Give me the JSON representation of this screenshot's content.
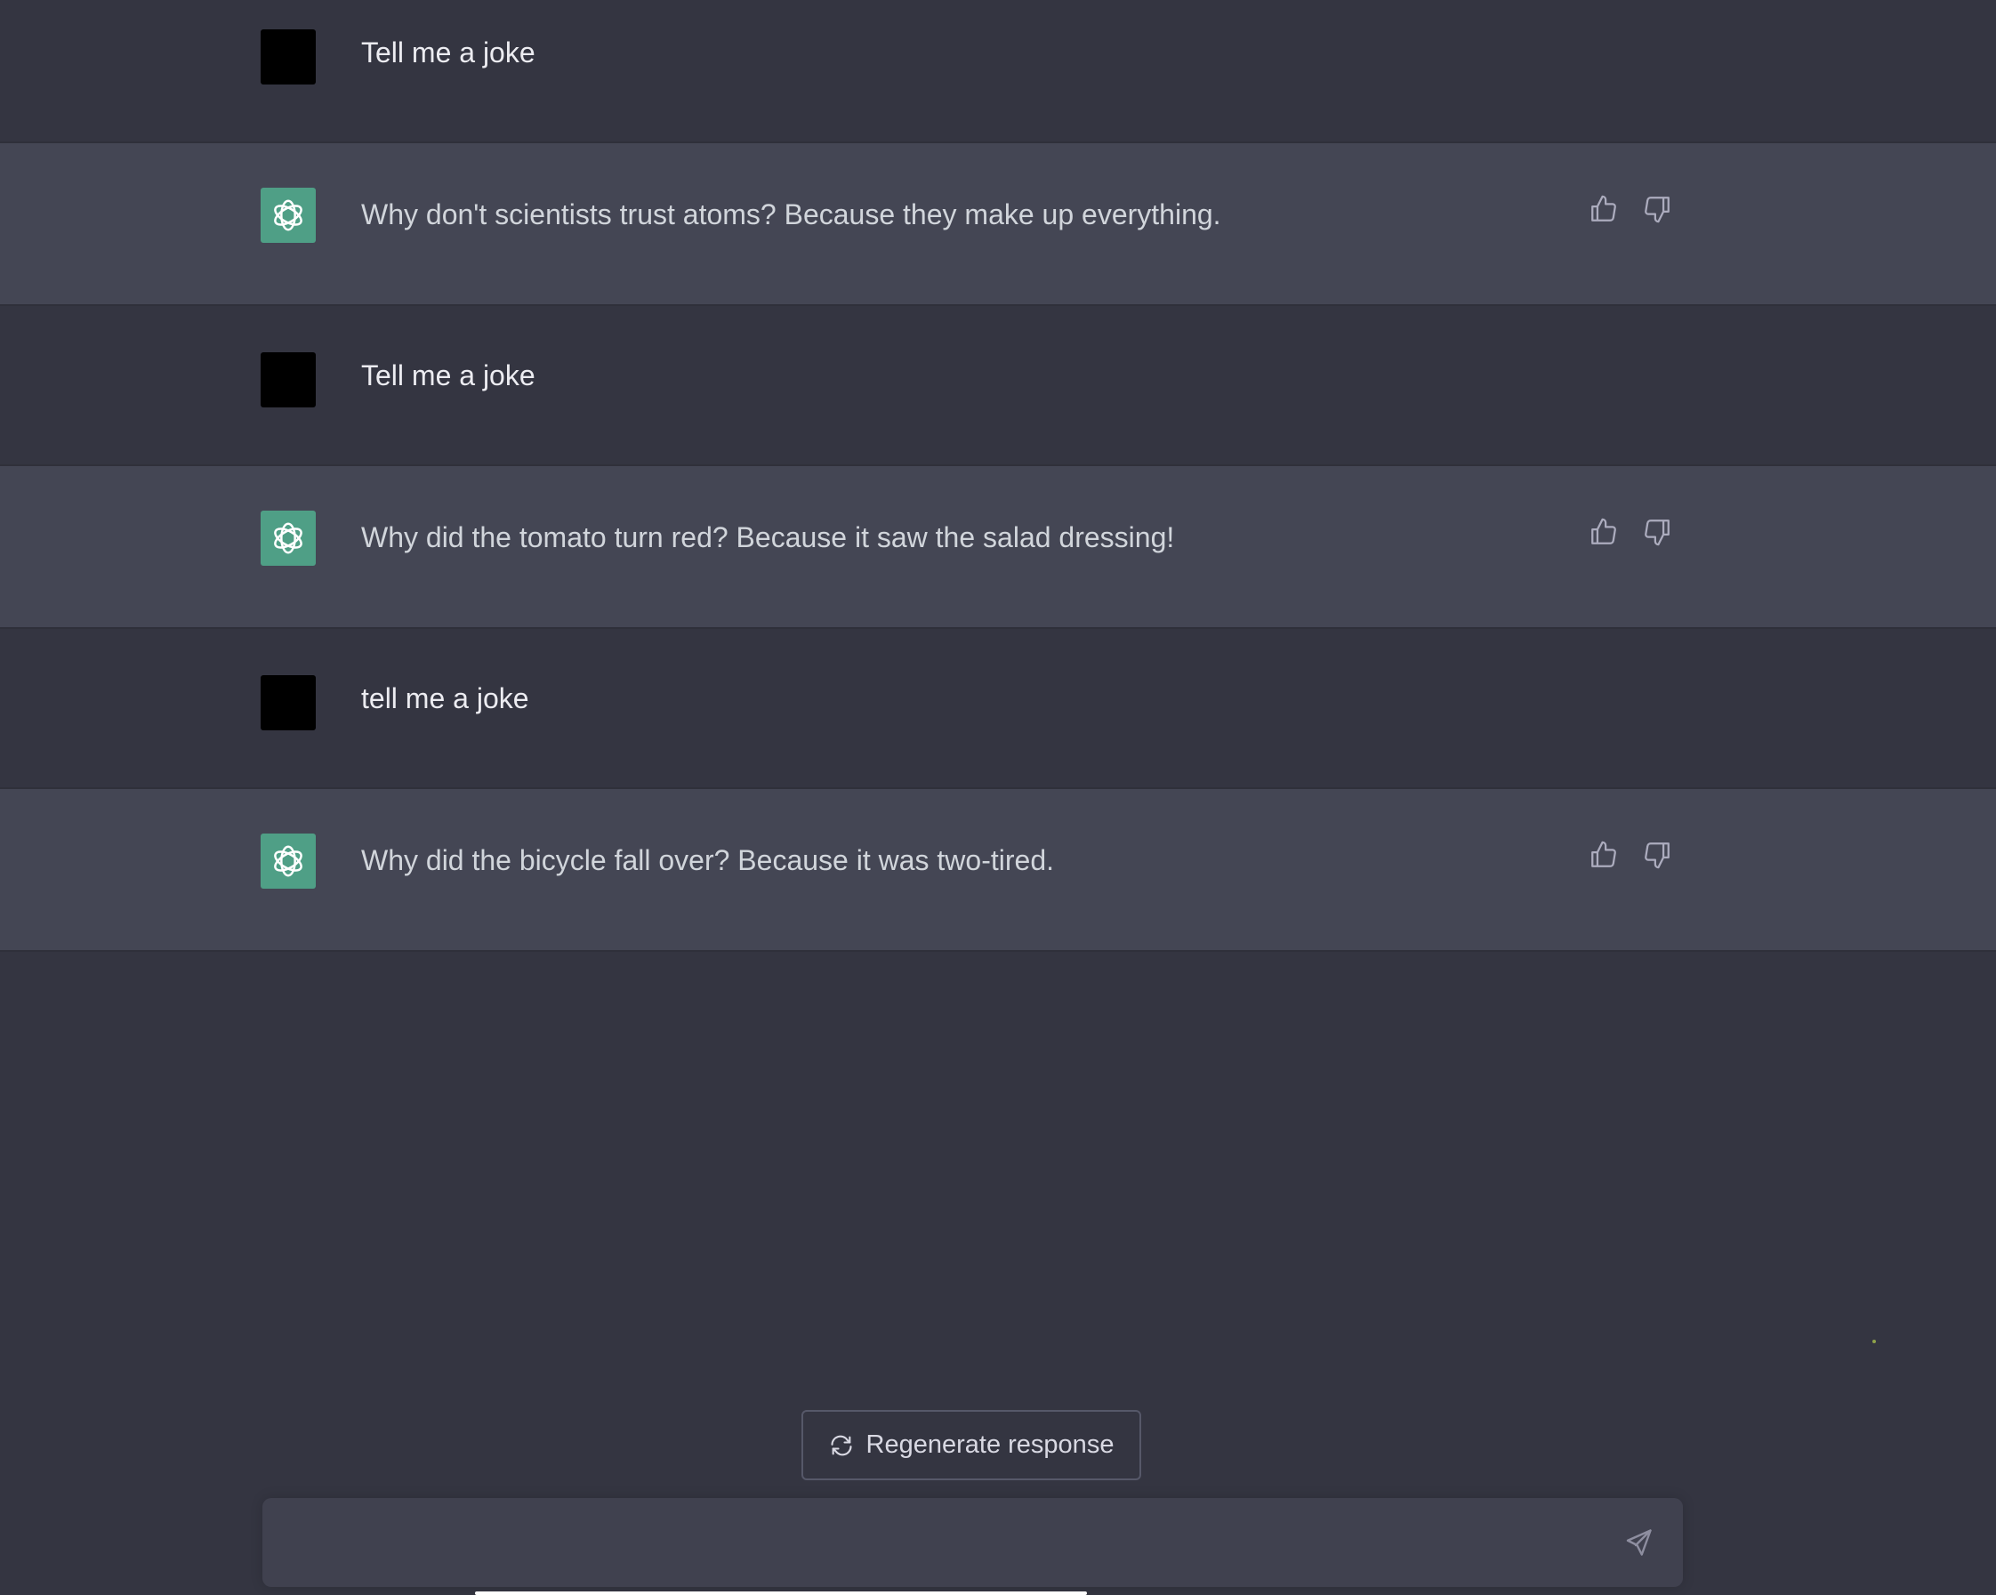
{
  "conversation": {
    "messages": [
      {
        "role": "user",
        "text": "Tell me a joke"
      },
      {
        "role": "assistant",
        "text": "Why don't scientists trust atoms? Because they make up everything."
      },
      {
        "role": "user",
        "text": "Tell me a joke"
      },
      {
        "role": "assistant",
        "text": "Why did the tomato turn red? Because it saw the salad dressing!"
      },
      {
        "role": "user",
        "text": "tell me a joke"
      },
      {
        "role": "assistant",
        "text": "Why did the bicycle fall over? Because it was two-tired."
      }
    ]
  },
  "controls": {
    "regenerate_label": "Regenerate response",
    "regenerate_icon": "refresh-icon",
    "send_icon": "paper-plane-icon",
    "composer_value": "",
    "thumbs_up_icon": "thumbs-up-icon",
    "thumbs_down_icon": "thumbs-down-icon"
  },
  "theme": {
    "background": "#343541",
    "assistant_row_background": "#444654",
    "assistant_avatar": "#4f9f86",
    "user_avatar": "#000000",
    "composer_background": "#40414f"
  }
}
